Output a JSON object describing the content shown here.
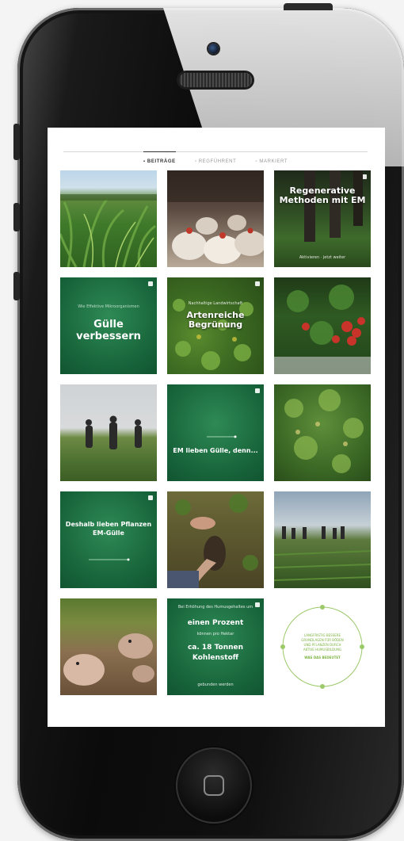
{
  "tabs": [
    {
      "label": "▪ BEITRÄGE",
      "active": true
    },
    {
      "label": "▫ REGFÜHRENT",
      "active": false
    },
    {
      "label": "▫ MARKIERT",
      "active": false
    }
  ],
  "tiles": {
    "t3": {
      "title": "Regenerative Methoden mit EM",
      "caption": "Aktivieren · jetzt weiter"
    },
    "t4": {
      "small": "Wie Effektive Mikroorganismen",
      "title": "Gülle verbessern"
    },
    "t5": {
      "small": "Nachhaltige Landwirtschaft",
      "title": "Artenreiche Begrünung"
    },
    "t8": {
      "title": "EM lieben Gülle, denn..."
    },
    "t10": {
      "title": "Deshalb lieben Pflanzen EM-Gülle"
    },
    "t14": {
      "line1": "Bei Erhöhung des Humusgehaltes um",
      "line2": "einen Prozent",
      "line3": "können pro Hektar",
      "line4": "ca. 18 Tonnen Kohlenstoff",
      "line5": "gebunden werden"
    },
    "t15": {
      "line1": "LANGFRISTIG BESSERE",
      "line2": "GRUNDLAGEN FÜR BÖDEN",
      "line3": "UND PFLANZEN DURCH",
      "line4": "AKTIVE HUMUSBILDUNG",
      "line5": "WAS DAS BEDEUTET"
    }
  }
}
